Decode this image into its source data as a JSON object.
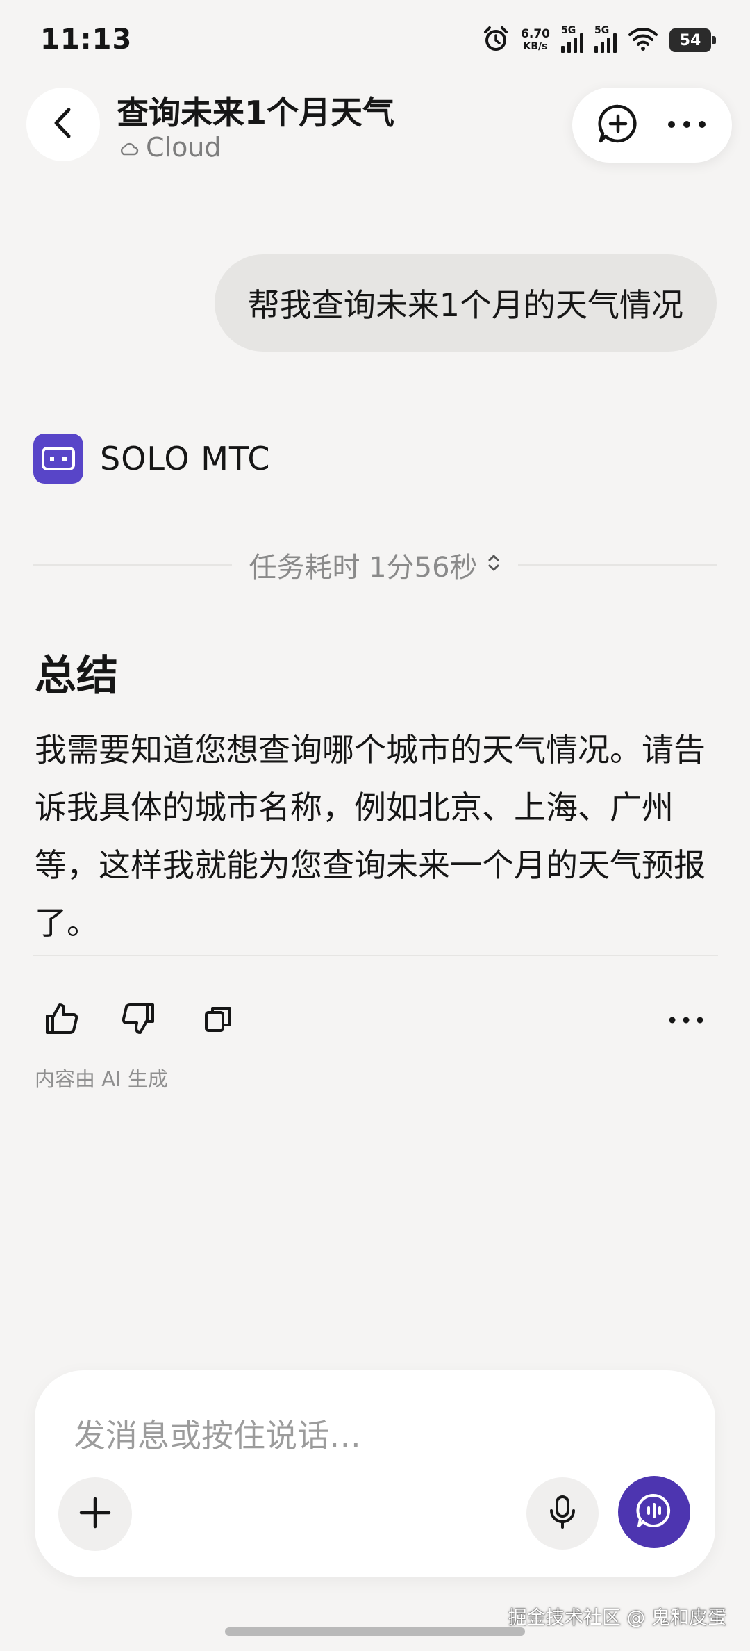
{
  "status_bar": {
    "time": "11:13",
    "net_speed_value": "6.70",
    "net_speed_unit": "KB/s",
    "signal1_label": "5G",
    "signal2_label": "5G",
    "battery": "54"
  },
  "header": {
    "title": "查询未来1个月天气",
    "subtitle": "Cloud",
    "icons": {
      "back": "chevron-left-icon",
      "new_chat": "plus-bubble-icon",
      "more": "more-horizontal-icon",
      "cloud": "cloud-icon"
    }
  },
  "conversation": {
    "user_message": "帮我查询未来1个月的天气情况",
    "agent": {
      "name": "SOLO MTC",
      "logo_color": "#5845c8",
      "task_time": "任务耗时 1分56秒",
      "summary_title": "总结",
      "summary_body": "我需要知道您想查询哪个城市的天气情况。请告诉我具体的城市名称，例如北京、上海、广州等，这样我就能为您查询未来一个月的天气预报了。",
      "ai_note": "内容由 AI 生成"
    }
  },
  "composer": {
    "placeholder": "发消息或按住说话…",
    "send_color": "#4d35b0"
  },
  "watermark": "掘金技术社区 @ 鬼和皮蛋"
}
